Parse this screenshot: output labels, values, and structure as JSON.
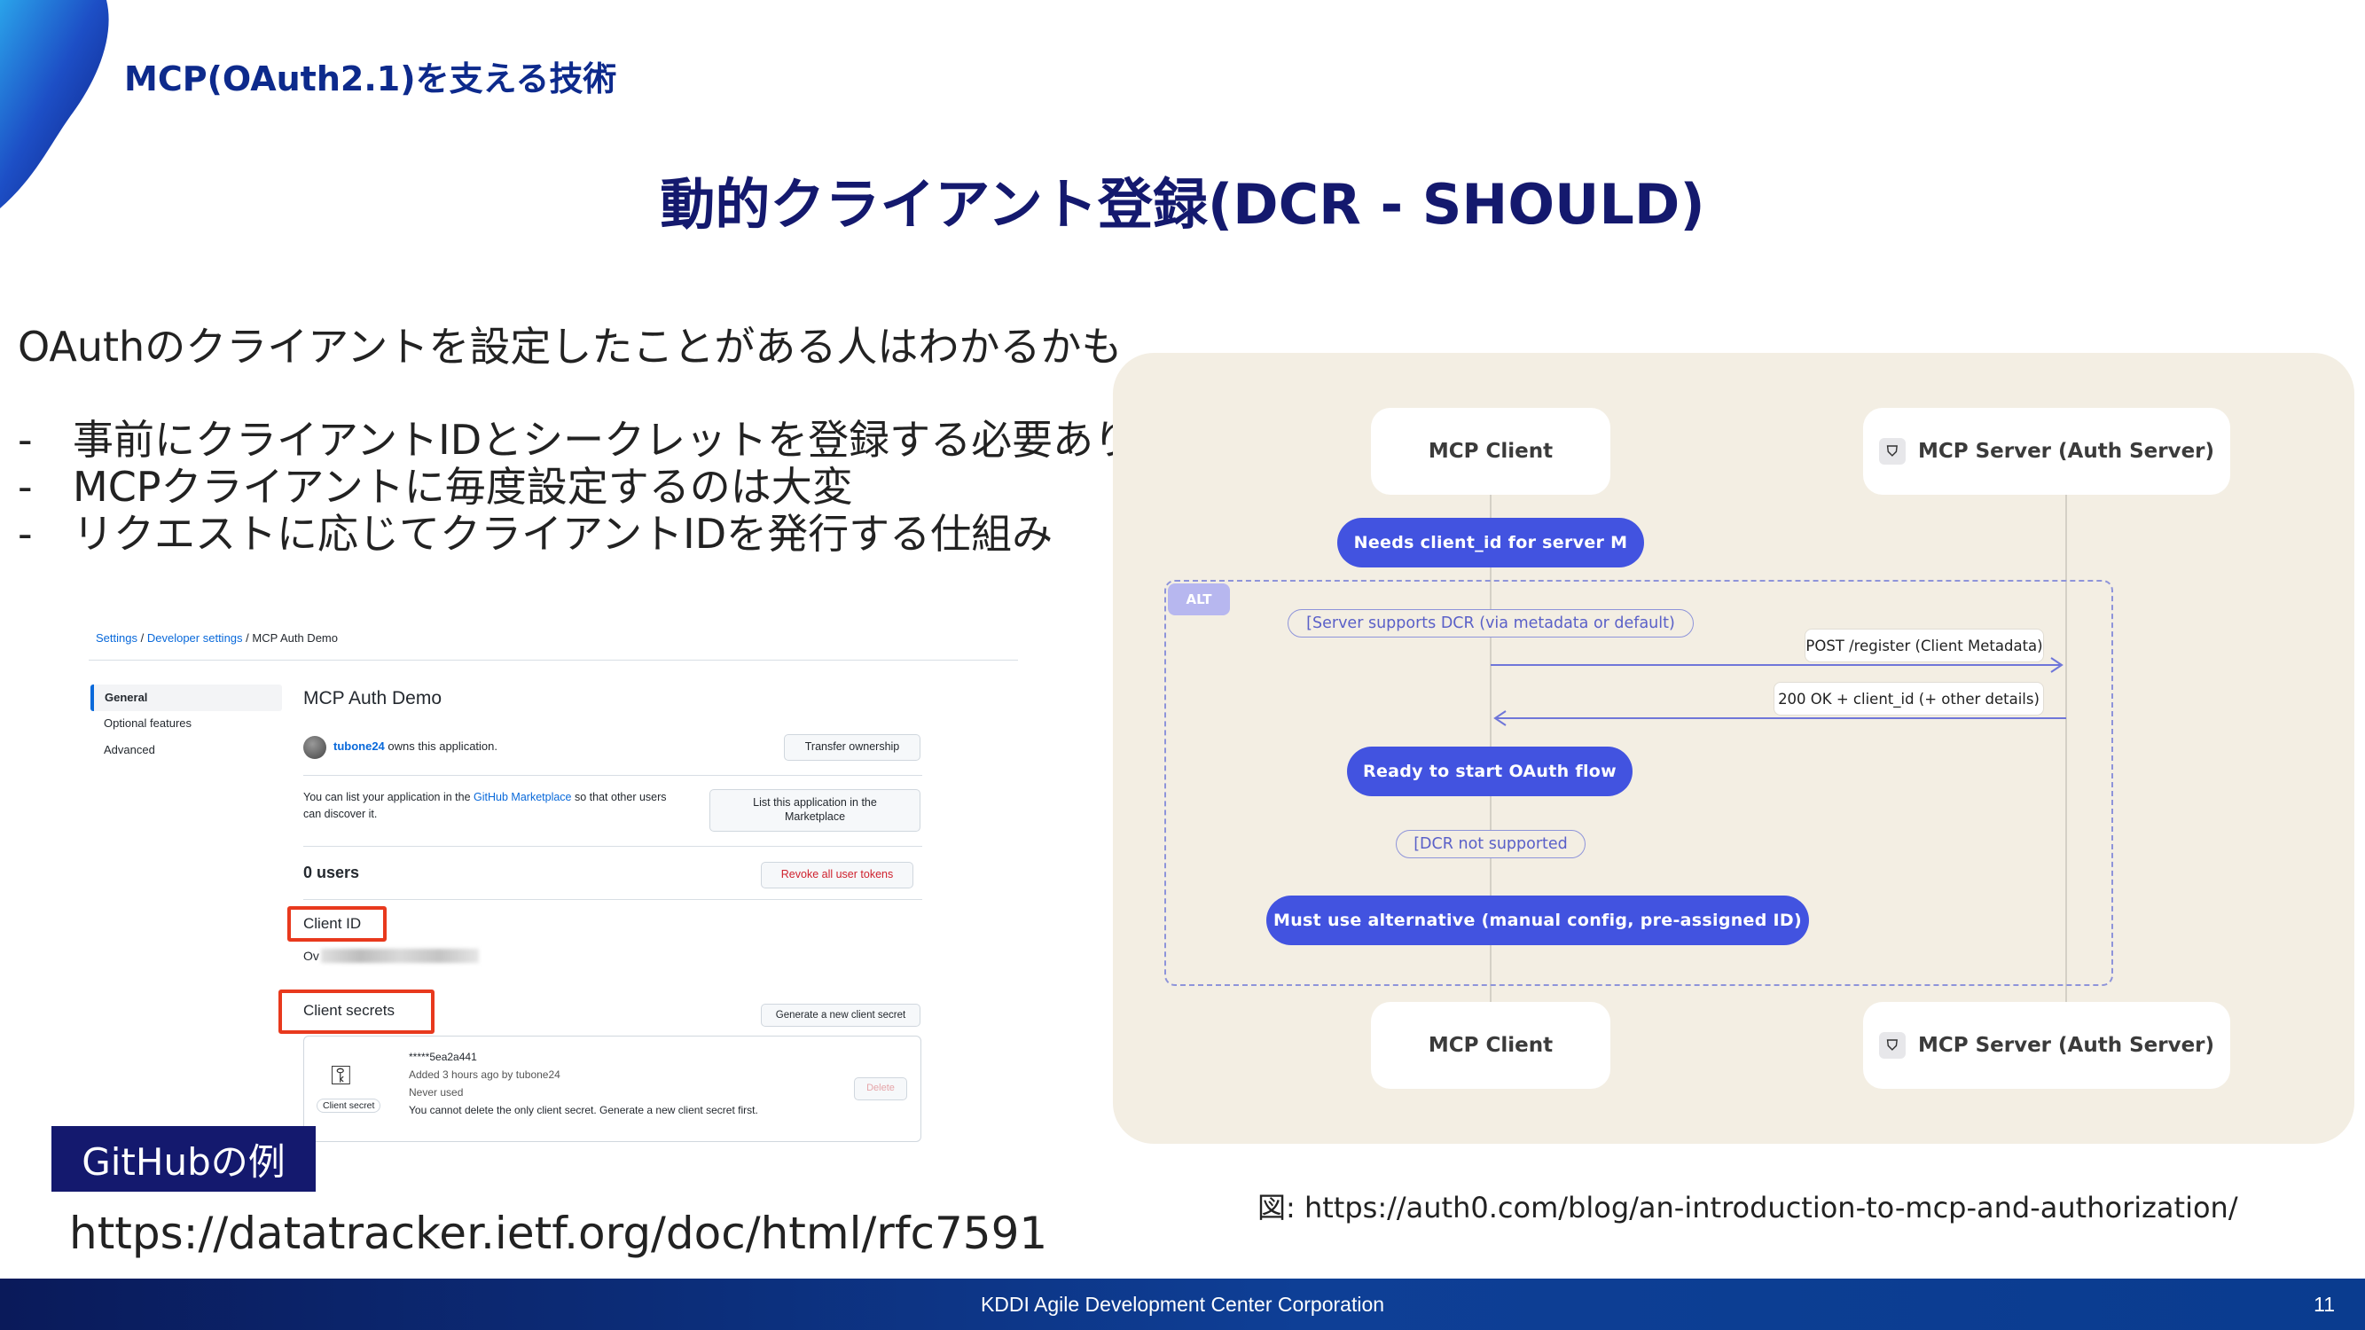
{
  "header": {
    "section_title": "MCP(OAuth2.1)を支える技術",
    "slide_title": "動的クライアント登録(DCR - SHOULD)"
  },
  "body": {
    "intro": "OAuthのクライアントを設定したことがある人はわかるかも",
    "bullets": [
      "事前にクライアントIDとシークレットを登録する必要あり",
      "MCPクライアントに毎度設定するのは大変",
      "リクエストに応じてクライアントIDを発行する仕組み"
    ],
    "bullet_marker": "-"
  },
  "github_example": {
    "breadcrumb": [
      "Settings",
      "Developer settings",
      "MCP Auth Demo"
    ],
    "breadcrumb_sep": "/",
    "nav": [
      "General",
      "Optional features",
      "Advanced"
    ],
    "app_title": "MCP Auth Demo",
    "owner_name": "tubone24",
    "owner_text": "owns this application.",
    "transfer_button": "Transfer ownership",
    "marketplace_text_1": "You can list your application in the",
    "marketplace_link": "GitHub Marketplace",
    "marketplace_text_2": "so that other users",
    "marketplace_text_3": "can discover it.",
    "marketplace_button": "List this application in the Marketplace",
    "users_count": "0 users",
    "revoke_button": "Revoke all user tokens",
    "client_id_label": "Client ID",
    "client_id_value": "Ov",
    "client_secrets_label": "Client secrets",
    "generate_button": "Generate a new client secret",
    "secret_masked": "*****5ea2a441",
    "secret_added": "Added 3 hours ago by tubone24",
    "secret_usage": "Never used",
    "secret_note": "You cannot delete the only client secret. Generate a new client secret first.",
    "secret_icon_label": "Client secret",
    "delete_button": "Delete",
    "caption": "GitHubの例"
  },
  "rfc_url": "https://datatracker.ietf.org/doc/html/rfc7591",
  "diagram": {
    "client_label": "MCP Client",
    "server_label": "MCP Server (Auth Server)",
    "needs_client_id": "Needs client_id for server M",
    "alt_tag": "ALT",
    "condition_dcr": "[Server supports DCR (via metadata or default)",
    "register_msg": "POST /register (Client Metadata)",
    "response_msg": "200 OK + client_id (+ other details)",
    "ready_msg": "Ready to start OAuth flow",
    "condition_no_dcr": "[DCR not supported",
    "alternative_msg": "Must use alternative (manual config, pre-assigned ID)",
    "accent_color": "#4253e0",
    "background_color": "#f3eee3"
  },
  "figure_caption": "図: https://auth0.com/blog/an-introduction-to-mcp-and-authorization/",
  "footer": {
    "company": "KDDI Agile Development Center Corporation",
    "page_number": "11"
  }
}
